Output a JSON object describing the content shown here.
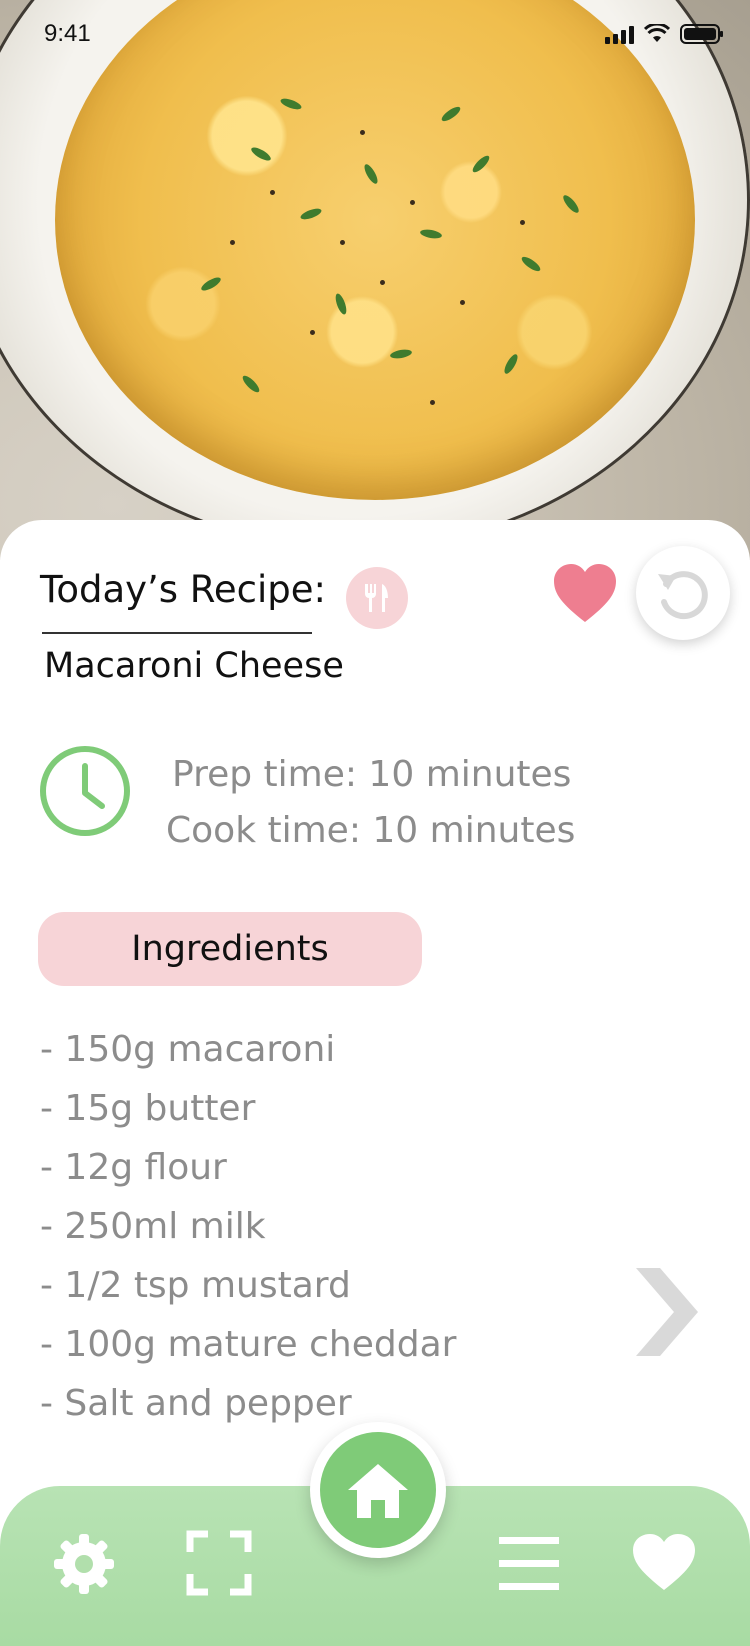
{
  "status_bar": {
    "time": "9:41"
  },
  "recipe": {
    "heading": "Today’s Recipe:",
    "name": "Macaroni Cheese",
    "prep_time": "Prep time: 10 minutes",
    "cook_time": "Cook time: 10 minutes"
  },
  "ingredients": {
    "label": "Ingredients",
    "items": [
      "- 150g macaroni",
      "- 15g butter",
      "- 12g flour",
      "- 250ml milk",
      "- 1/2 tsp mustard",
      "- 100g mature cheddar",
      "- Salt and pepper"
    ]
  },
  "colors": {
    "accent_green": "#7fcb78",
    "accent_pink": "#f7d4d7",
    "heart_pink": "#ee7e90",
    "muted_text": "#8c8c8c"
  },
  "icons": {
    "favorite": "heart-icon",
    "refresh": "reload-icon",
    "clock": "clock-icon",
    "meal": "utensils-icon",
    "next": "chevron-right-icon",
    "nav": [
      "gear-icon",
      "scan-icon",
      "home-icon",
      "menu-icon",
      "heart-icon"
    ]
  }
}
